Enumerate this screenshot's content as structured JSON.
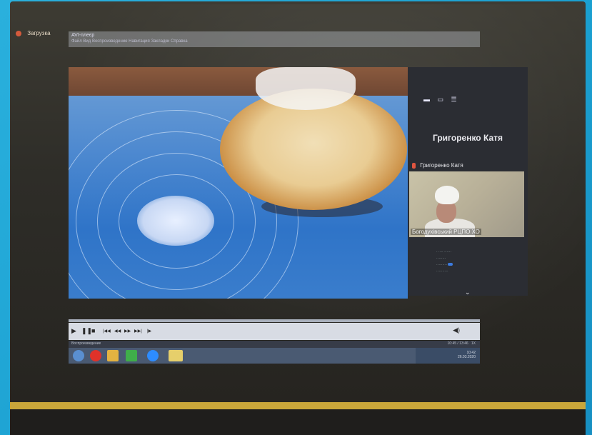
{
  "desktop": {
    "app_label": "Загрузка"
  },
  "player": {
    "title": "AVI-плеєр",
    "menu": "Файл  Вид  Воспроизведение  Навигация  Закладки  Справка",
    "status": "Воспроизведение",
    "time": "10:45 / 13:46",
    "speed": "1X"
  },
  "zoom": {
    "participant_name_big": "Григоренко Катя",
    "participant_name_small": "Григоренко Катя",
    "webcam_label": "Богодухівський РЦПО ХО",
    "menu_items": [
      "",
      "",
      "",
      ""
    ],
    "top_icons": [
      "minimize-icon",
      "view-icon",
      "menu-icon"
    ]
  },
  "taskbar": {
    "icons": [
      "start-icon",
      "opera-icon",
      "folder-icon",
      "player-icon",
      "zoom-icon",
      "explorer-icon"
    ],
    "tray_time": "10:42",
    "tray_date": "26.03.2020"
  },
  "colors": {
    "zoom_panel": "#2b2d33",
    "mic_muted": "#e05540",
    "toggle": "#3c7be0",
    "laptop_trim": "#c9a63a"
  }
}
